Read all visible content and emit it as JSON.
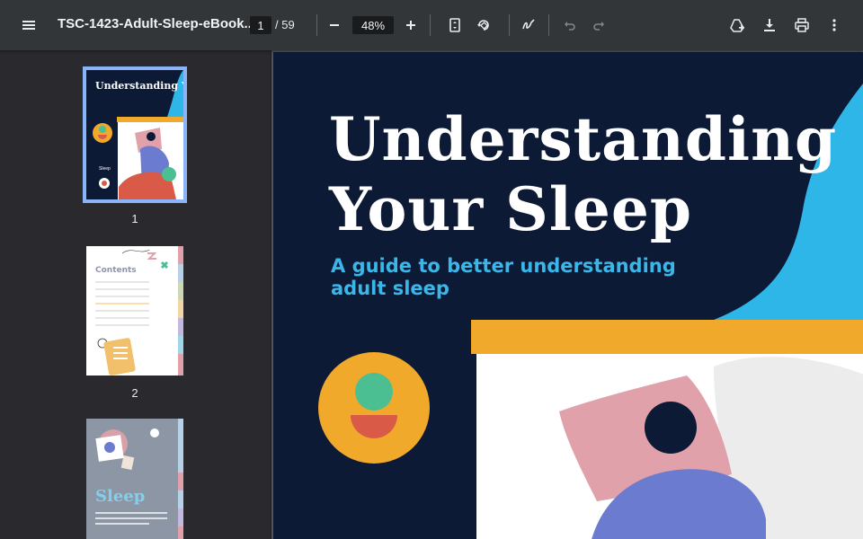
{
  "toolbar": {
    "document_title": "TSC-1423-Adult-Sleep-eBook...",
    "current_page": "1",
    "page_total": "/ 59",
    "zoom": "48%",
    "icons": [
      "menu-icon",
      "zoom-out-icon",
      "zoom-in-icon",
      "fit-page-icon",
      "rotate-icon",
      "annotate-icon",
      "undo-icon",
      "redo-icon",
      "drive-icon",
      "download-icon",
      "print-icon",
      "more-icon"
    ]
  },
  "sidebar": {
    "thumbnails": [
      {
        "number": "1",
        "title": "Understanding Your Sleep",
        "subtitle": "A guide to better understanding adult sleep"
      },
      {
        "number": "2",
        "title": "Contents"
      },
      {
        "number": "3",
        "title": "Sleep"
      }
    ]
  },
  "page": {
    "title_line1": "Understanding",
    "title_line2": "Your Sleep",
    "subtitle_line1": "A guide to better understanding",
    "subtitle_line2": "adult sleep",
    "colors": {
      "background": "#0c1a35",
      "accent_blue": "#2fb6e8",
      "accent_yellow": "#f0a92a",
      "pillow_pink": "#e0a1aa",
      "body_blue": "#6a7bd0"
    }
  }
}
